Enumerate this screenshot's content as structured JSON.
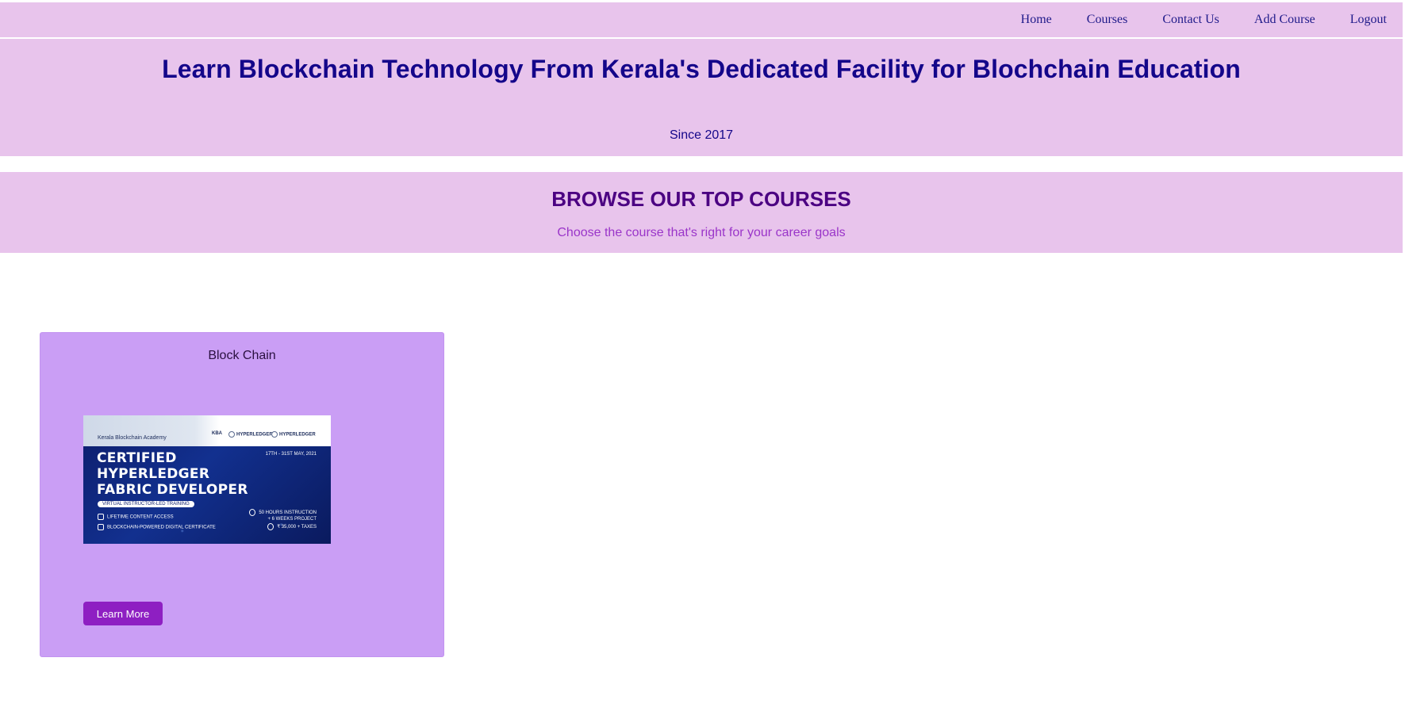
{
  "nav": {
    "items": [
      {
        "label": "Home"
      },
      {
        "label": "Courses"
      },
      {
        "label": "Contact Us"
      },
      {
        "label": "Add Course"
      },
      {
        "label": "Logout"
      }
    ]
  },
  "hero": {
    "title": "Learn Blockchain Technology From Kerala's Dedicated Facility for Blochchain Education",
    "subtitle": "Since 2017"
  },
  "browse": {
    "title": "BROWSE OUR TOP COURSES",
    "subtitle": "Choose the course that's right for your career goals"
  },
  "courses": [
    {
      "title": "Block Chain",
      "image": {
        "academy": "Kerala Blockchain Academy",
        "logo_left": "HYPERLEDGER",
        "logo_right": "HYPERLEDGER",
        "logo_small": "KBA",
        "date": "17TH - 31ST MAY, 2021",
        "headline_1": "CERTIFIED",
        "headline_2": "HYPERLEDGER",
        "headline_3": "FABRIC DEVELOPER",
        "pill": "VIRTUAL INSTRUCTOR-LED TRAINING",
        "feature_1": "LIFETIME CONTENT ACCESS",
        "feature_2": "BLOCKCHAIN-POWERED DIGITAL CERTIFICATE",
        "info_1a": "50 HOURS INSTRUCTION",
        "info_1b": "+ 6 WEEKS PROJECT",
        "info_2": "₹ 35,000 + TAXES"
      },
      "button_label": "Learn More"
    }
  ],
  "colors": {
    "band": "#e8c4ec",
    "heading": "#14068a",
    "browse_heading": "#4b0082",
    "browse_sub": "#9a35c9",
    "card": "#ca9ef5",
    "button": "#8e1fc2"
  }
}
